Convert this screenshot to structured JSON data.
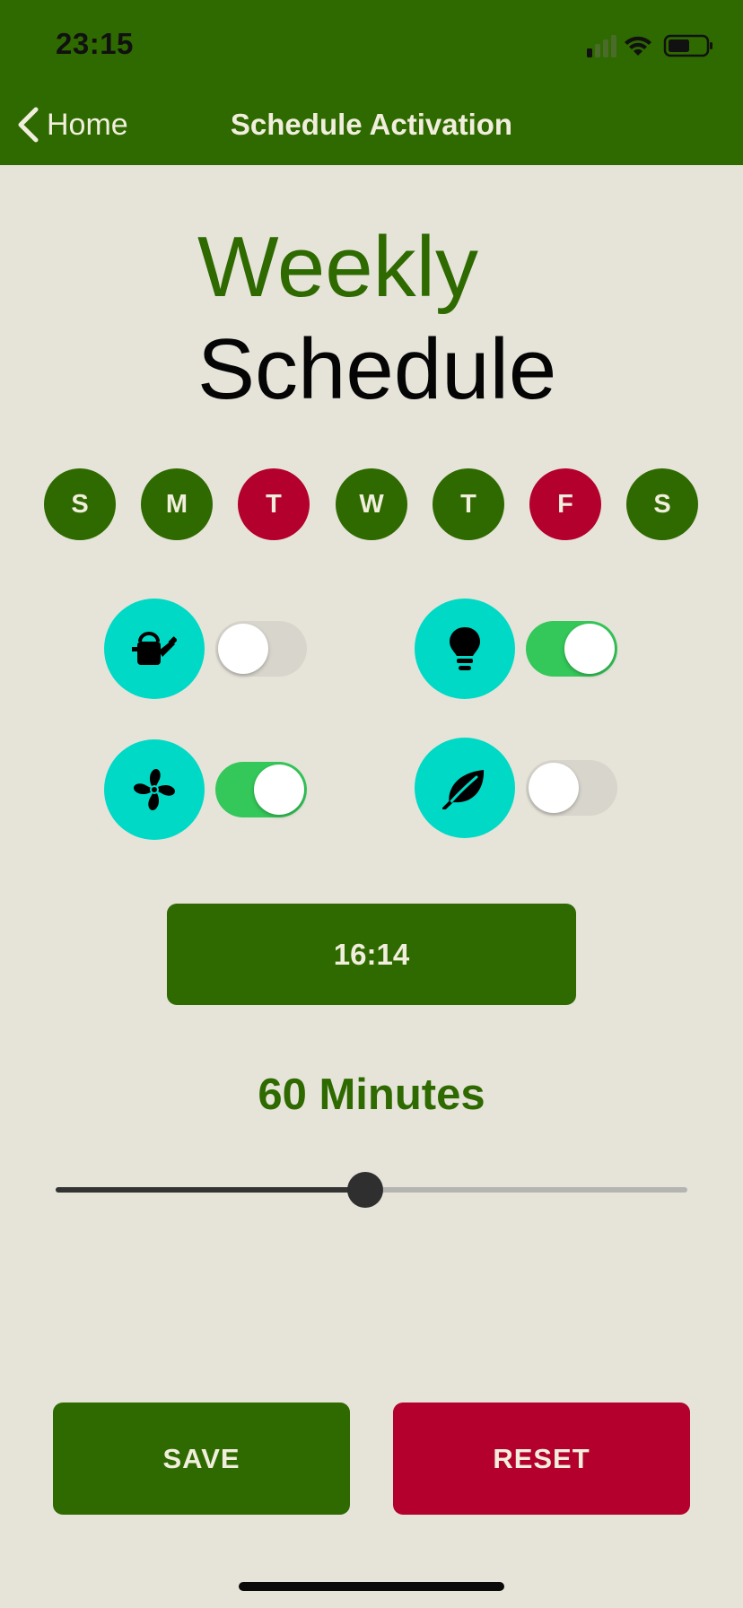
{
  "status_bar": {
    "time": "23:15"
  },
  "nav": {
    "back_label": "Home",
    "title": "Schedule Activation"
  },
  "heading": {
    "line1": "Weekly",
    "line2": "Schedule"
  },
  "days": [
    {
      "label": "S",
      "color": "#2e6a00"
    },
    {
      "label": "M",
      "color": "#2e6a00"
    },
    {
      "label": "T",
      "color": "#b3002c"
    },
    {
      "label": "W",
      "color": "#2e6a00"
    },
    {
      "label": "T",
      "color": "#2e6a00"
    },
    {
      "label": "F",
      "color": "#b3002c"
    },
    {
      "label": "S",
      "color": "#2e6a00"
    }
  ],
  "devices": [
    {
      "icon": "watering-can-icon",
      "toggle": "off"
    },
    {
      "icon": "lightbulb-icon",
      "toggle": "on"
    },
    {
      "icon": "fan-icon",
      "toggle": "on"
    },
    {
      "icon": "leaf-icon",
      "toggle": "off"
    }
  ],
  "time": {
    "value": "16:14"
  },
  "duration": {
    "label": "60 Minutes",
    "slider_fraction": 0.49
  },
  "actions": {
    "save_label": "SAVE",
    "reset_label": "RESET"
  },
  "colors": {
    "primary": "#2e6a00",
    "danger": "#b3002c",
    "accent": "#00d9c6",
    "toggle_on": "#34c759",
    "background": "#e6e4d9"
  }
}
